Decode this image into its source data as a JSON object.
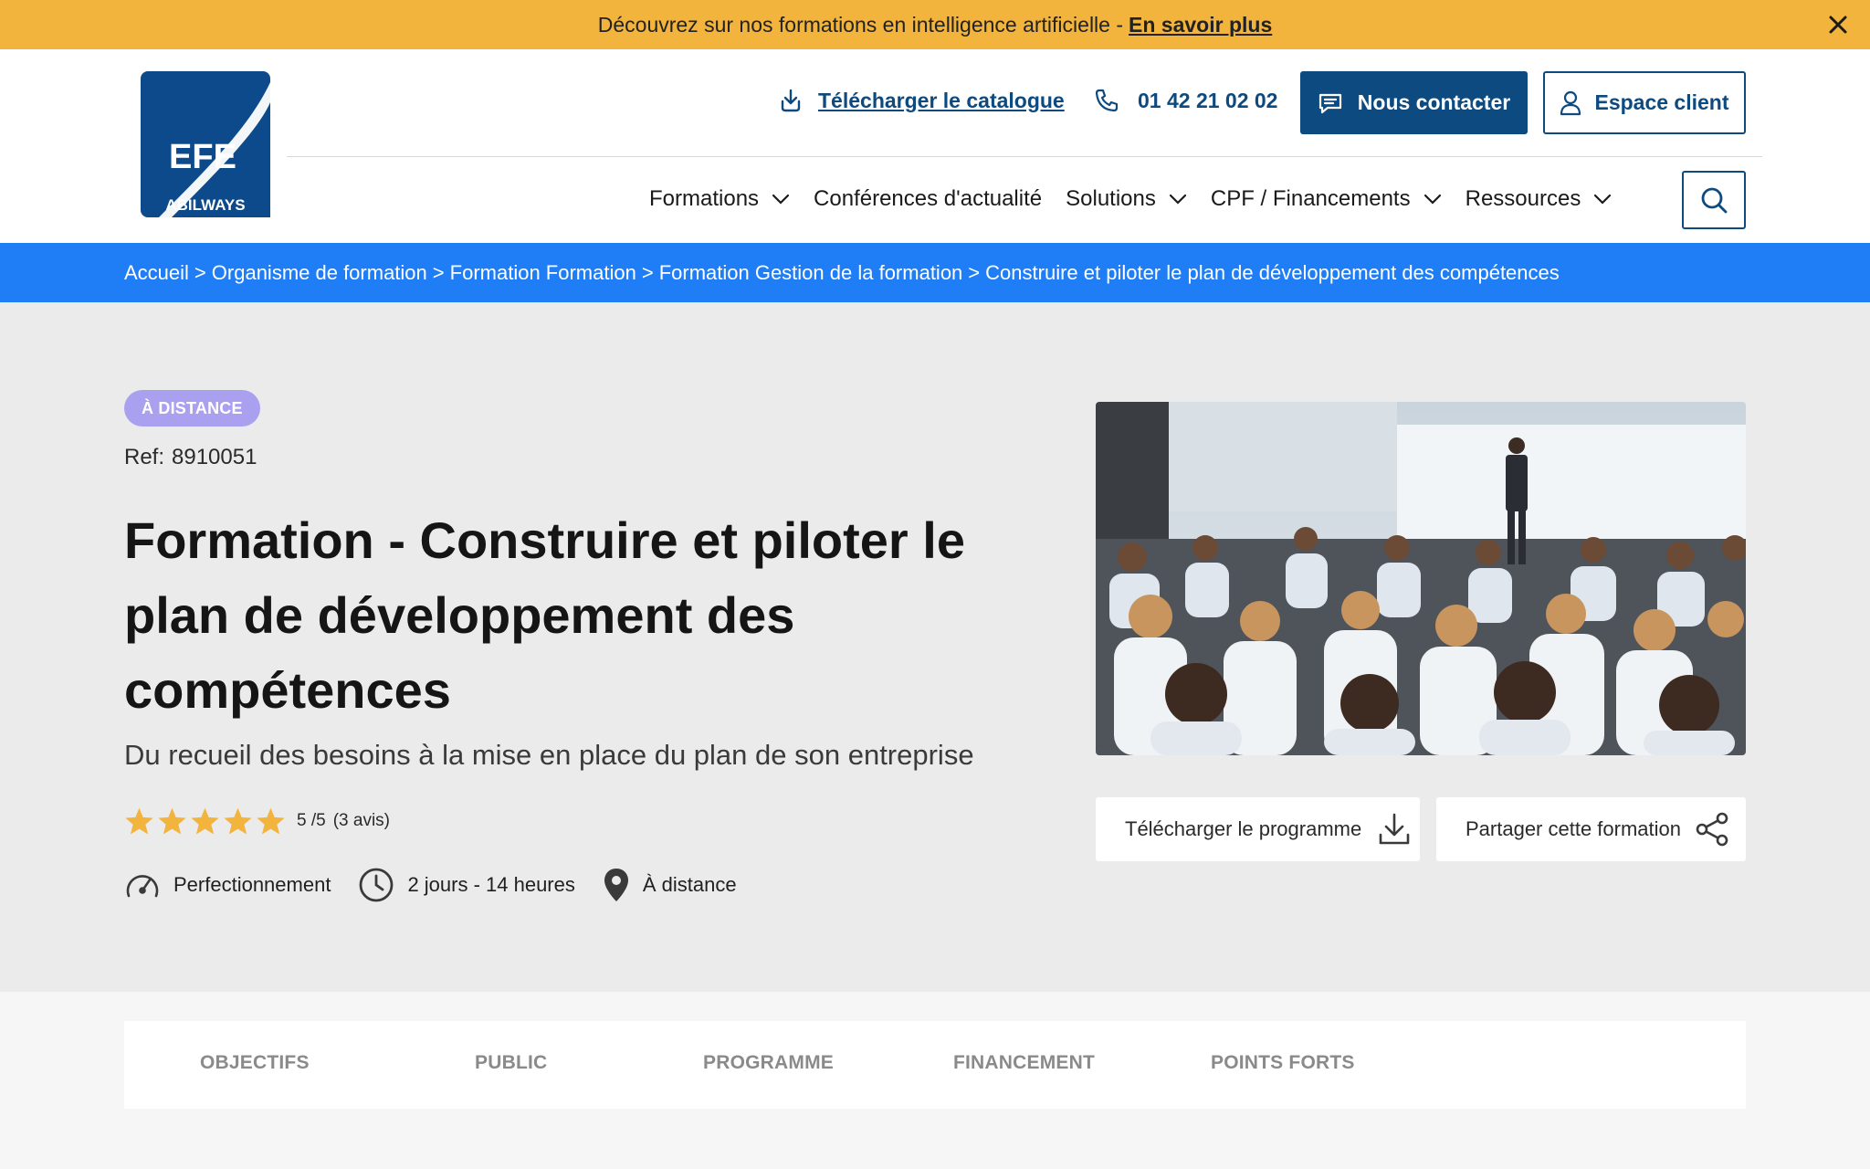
{
  "announcement": {
    "text": "Découvrez sur nos formations en intelligence artificielle -",
    "link": "En savoir plus"
  },
  "header": {
    "logo": {
      "brand": "EFE",
      "sub": "ABILWAYS"
    },
    "catalogue_link": "Télécharger le catalogue",
    "phone": "01 42 21 02 02",
    "contact_button": "Nous contacter",
    "client_button": "Espace client",
    "nav": [
      "Formations",
      "Conférences d'actualité",
      "Solutions",
      "CPF / Financements",
      "Ressources"
    ]
  },
  "breadcrumb": [
    "Accueil",
    "Organisme de formation",
    "Formation Formation",
    "Formation Gestion de la formation",
    "Construire et piloter le plan de développement des compétences"
  ],
  "course": {
    "badge": "À DISTANCE",
    "ref_label": "Ref:",
    "ref_value": "8910051",
    "title": "Formation - Construire et piloter le plan de développement des compétences",
    "subtitle": "Du recueil des besoins à la mise en place du plan de son entreprise",
    "rating": {
      "value": 5,
      "score_text": "5 /5",
      "count_text": "(3 avis)"
    },
    "level": "Perfectionnement",
    "duration": "2 jours - 14 heures",
    "location": "À distance"
  },
  "actions": {
    "download_program": "Télécharger le programme",
    "share": "Partager cette formation"
  },
  "tabs": [
    "OBJECTIFS",
    "PUBLIC",
    "PROGRAMME",
    "FINANCEMENT",
    "POINTS FORTS"
  ],
  "colors": {
    "announcement_bg": "#f2b43d",
    "brand_blue": "#0d4a80",
    "breadcrumb_bg": "#1f7ef5",
    "badge_bg": "#a9a0f0",
    "star": "#f2b43d"
  }
}
